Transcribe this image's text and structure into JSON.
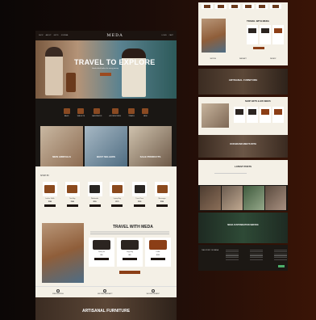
{
  "left": {
    "logo": "MEDA",
    "nav": [
      "SHOP",
      "ABOUT",
      "GIFTS",
      "JOURNAL"
    ],
    "account_links": [
      "LOGIN",
      "CART"
    ],
    "hero": {
      "title": "TRAVEL TO EXPLORE",
      "subtitle": "Handcrafted leather for every journey",
      "button": "SHOP NOW"
    },
    "categories": [
      "BAGS",
      "WALLETS",
      "BACKPACKS",
      "ACCESSORIES",
      "TRAVEL",
      "NEW"
    ],
    "promos": [
      "NEW ARRIVALS",
      "BEST SELLERS",
      "SALE PRODUCTS"
    ],
    "shop": {
      "heading": "SHOP BY",
      "products": [
        {
          "name": "Leather Duffle",
          "price": "$189",
          "color": "brown"
        },
        {
          "name": "Tote Bag",
          "price": "$149",
          "color": "brown"
        },
        {
          "name": "Weekender",
          "price": "$219",
          "color": "dark"
        },
        {
          "name": "Laptop Bag",
          "price": "$179",
          "color": "brown"
        },
        {
          "name": "Travel Case",
          "price": "$129",
          "color": "dark"
        },
        {
          "name": "Messenger",
          "price": "$159",
          "color": "brown"
        }
      ]
    },
    "travel": {
      "title": "TRAVEL WITH MEDA",
      "cards": [
        {
          "name": "Toiletry Kit",
          "price": "$59",
          "color": "dark"
        },
        {
          "name": "Dopp Bag",
          "price": "$69",
          "color": "dark"
        },
        {
          "name": "Duffle",
          "price": "$199",
          "color": "brown"
        }
      ],
      "button": "VIEW MORE"
    },
    "features": [
      "FREE SHIPPING",
      "LIFETIME WARRANTY",
      "SECURE PAYMENT"
    ],
    "artisanal": {
      "title": "ARTISANAL FURNITURE",
      "button": "SHOP"
    }
  },
  "right": {
    "travel_title": "TRAVEL WITH MEDA",
    "features": [
      "SHIPPING",
      "WARRANTY",
      "PAYMENT"
    ],
    "artisanal_title": "ARTISANAL FURNITURE",
    "gift_title": "SHOP GIFTS & HIS SEEKS",
    "shop_title": "OUR BRAND MEETS WITH",
    "posts_title": "LATEST POSTS",
    "custom_title": "MEDA CUSTOMIZATION SERVICE",
    "footer_title": "THE STORY OF MEDA"
  },
  "colors": {
    "accent": "#8b3e16",
    "cream": "#f4f0e6",
    "dark": "#1c1410"
  }
}
